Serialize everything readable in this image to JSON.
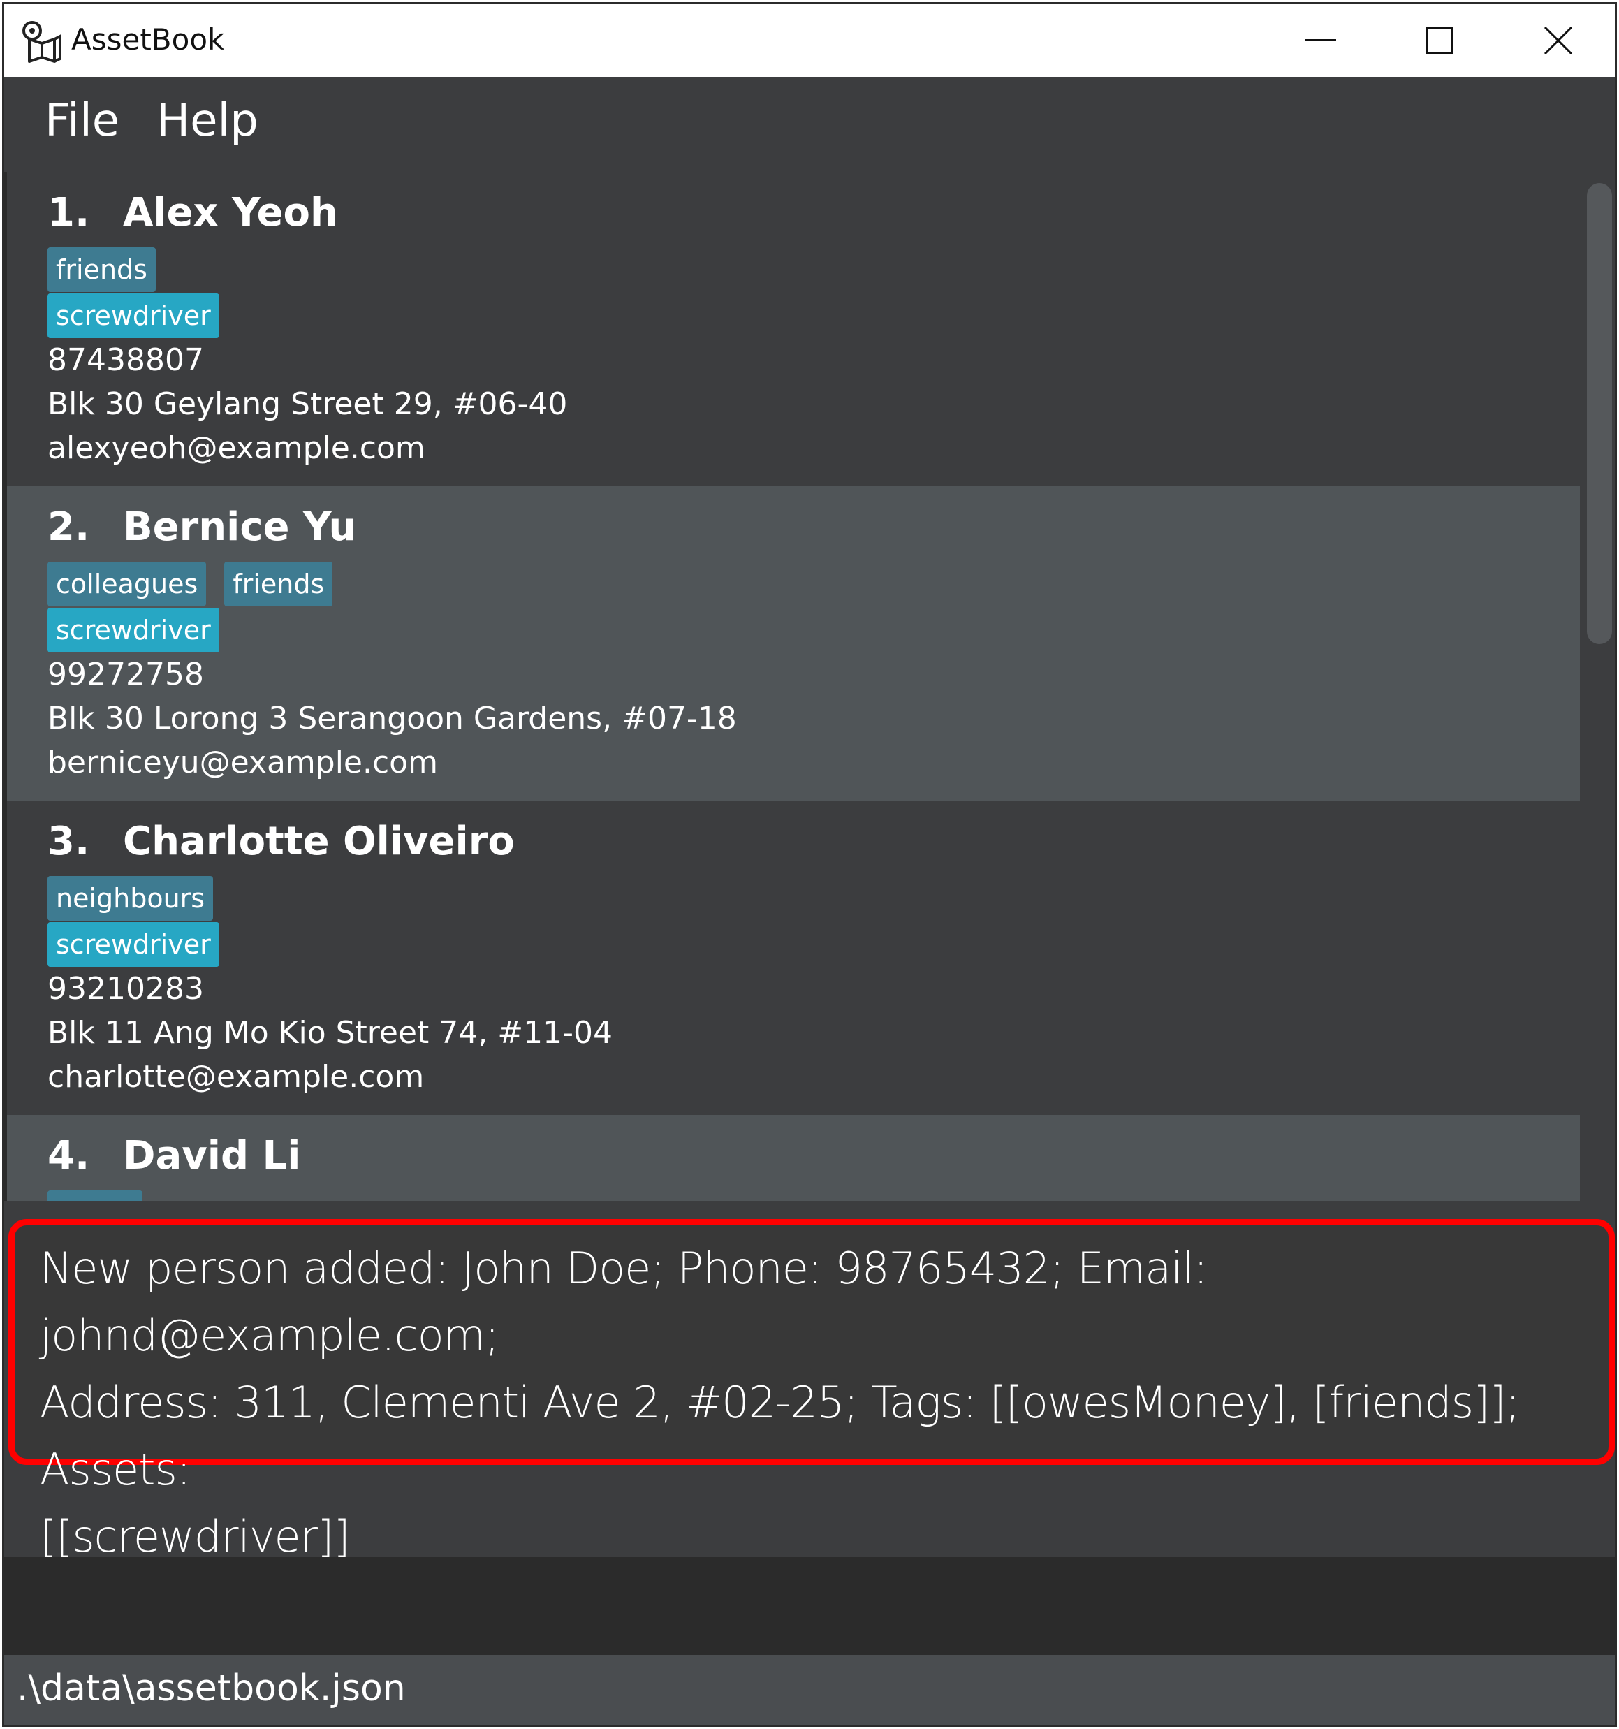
{
  "window": {
    "title": "AssetBook",
    "icon": "assetbook-logo-icon",
    "controls": [
      "minimize-icon",
      "maximize-icon",
      "close-icon"
    ]
  },
  "menu": {
    "file": "File",
    "help": "Help"
  },
  "persons": [
    {
      "index": "1.",
      "name": "Alex Yeoh",
      "tags": [
        "friends"
      ],
      "assets": [
        "screwdriver"
      ],
      "phone": "87438807",
      "address": "Blk 30 Geylang Street 29, #06-40",
      "email": "alexyeoh@example.com"
    },
    {
      "index": "2.",
      "name": "Bernice Yu",
      "tags": [
        "colleagues",
        "friends"
      ],
      "assets": [
        "screwdriver"
      ],
      "phone": "99272758",
      "address": "Blk 30 Lorong 3 Serangoon Gardens, #07-18",
      "email": "berniceyu@example.com"
    },
    {
      "index": "3.",
      "name": "Charlotte Oliveiro",
      "tags": [
        "neighbours"
      ],
      "assets": [
        "screwdriver"
      ],
      "phone": "93210283",
      "address": "Blk 11 Ang Mo Kio Street 74, #11-04",
      "email": "charlotte@example.com"
    },
    {
      "index": "4.",
      "name": "David Li"
    }
  ],
  "result": {
    "line1": "New person added: John Doe; Phone: 98765432; Email: johnd@example.com;",
    "line2": "Address: 311, Clementi Ave 2, #02-25; Tags: [[owesMoney], [friends]]; Assets:",
    "line3": "[[screwdriver]]"
  },
  "command_box": {
    "value": ""
  },
  "status_bar": {
    "path": ".\\data\\assetbook.json"
  },
  "colors": {
    "highlight_border": "#ff0000",
    "tag_bg": "#3e7b91",
    "asset_bg": "#27a7c4"
  }
}
